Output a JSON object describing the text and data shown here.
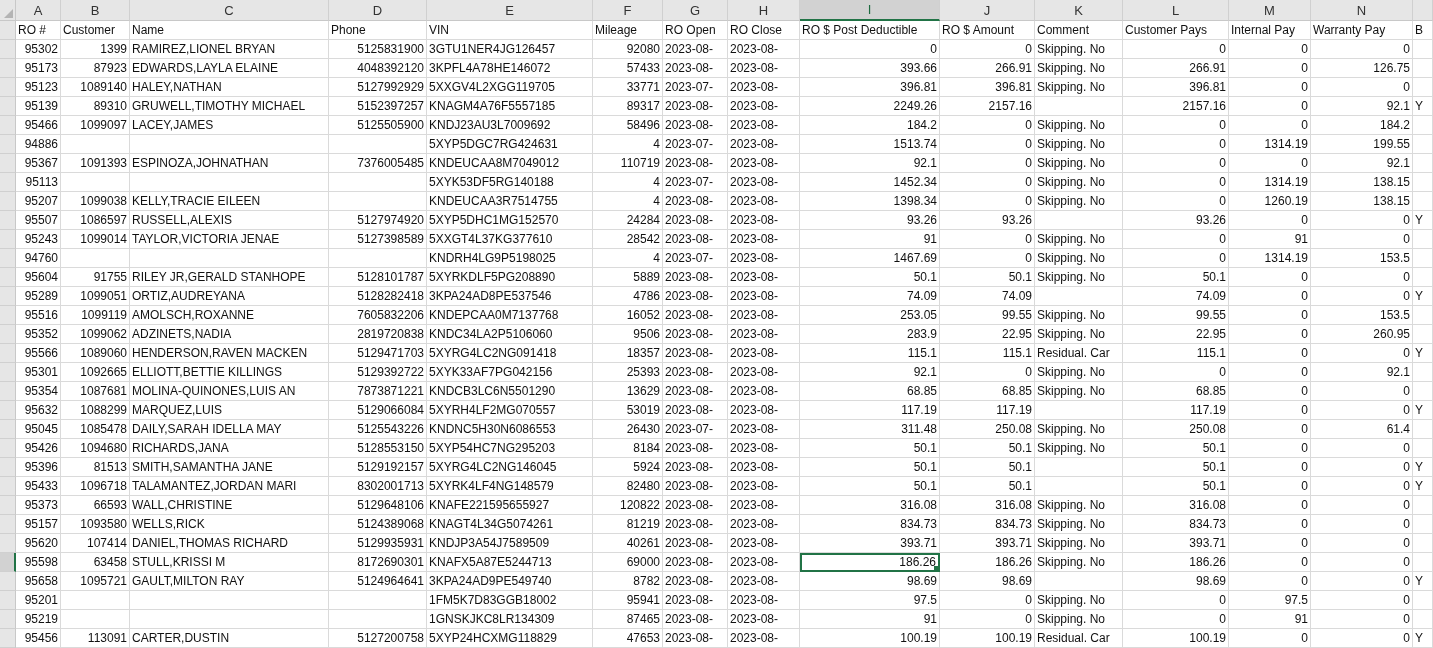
{
  "columns": [
    {
      "letter": "A",
      "selected": false
    },
    {
      "letter": "B",
      "selected": false
    },
    {
      "letter": "C",
      "selected": false
    },
    {
      "letter": "D",
      "selected": false
    },
    {
      "letter": "E",
      "selected": false
    },
    {
      "letter": "F",
      "selected": false
    },
    {
      "letter": "G",
      "selected": false
    },
    {
      "letter": "H",
      "selected": false
    },
    {
      "letter": "I",
      "selected": true
    },
    {
      "letter": "J",
      "selected": false
    },
    {
      "letter": "K",
      "selected": false
    },
    {
      "letter": "L",
      "selected": false
    },
    {
      "letter": "M",
      "selected": false
    },
    {
      "letter": "N",
      "selected": false
    },
    {
      "selected": false
    }
  ],
  "header_row": {
    "A": "RO #",
    "B": "Customer",
    "C": "Name",
    "D": "Phone",
    "E": "VIN",
    "F": "Mileage",
    "G": "RO Open",
    "H": "RO Close",
    "I": "RO $ Post Deductible",
    "J": "RO $ Amount",
    "K": "Comment",
    "L": "Customer Pays",
    "M": "Internal Pay",
    "N": "Warranty Pay",
    "O": "B"
  },
  "rows": [
    {
      "selected": false,
      "cells": {
        "A": "95302",
        "B": "1399",
        "C": "RAMIREZ,LIONEL BRYAN",
        "D": "5125831900",
        "E": "3GTU1NER4JG126457",
        "F": "92080",
        "G": "2023-08-",
        "H": "2023-08-",
        "I": "0",
        "J": "0",
        "K": "Skipping. No",
        "L": "0",
        "M": "0",
        "N": "0"
      }
    },
    {
      "selected": false,
      "cells": {
        "A": "95173",
        "B": "87923",
        "C": "EDWARDS,LAYLA ELAINE",
        "D": "4048392120",
        "E": "3KPFL4A78HE146072",
        "F": "57433",
        "G": "2023-08-",
        "H": "2023-08-",
        "I": "393.66",
        "J": "266.91",
        "K": "Skipping. No",
        "L": "266.91",
        "M": "0",
        "N": "126.75"
      }
    },
    {
      "selected": false,
      "cells": {
        "A": "95123",
        "B": "1089140",
        "C": "HALEY,NATHAN",
        "D": "5127992929",
        "E": "5XXGV4L2XGG119705",
        "F": "33771",
        "G": "2023-07-",
        "H": "2023-08-",
        "I": "396.81",
        "J": "396.81",
        "K": "Skipping. No",
        "L": "396.81",
        "M": "0",
        "N": "0"
      }
    },
    {
      "selected": false,
      "cells": {
        "A": "95139",
        "B": "89310",
        "C": "GRUWELL,TIMOTHY MICHAEL",
        "D": "5152397257",
        "E": "KNAGM4A76F5557185",
        "F": "89317",
        "G": "2023-08-",
        "H": "2023-08-",
        "I": "2249.26",
        "J": "2157.16",
        "L": "2157.16",
        "M": "0",
        "N": "92.1",
        "O": "Y"
      }
    },
    {
      "selected": false,
      "cells": {
        "A": "95466",
        "B": "1099097",
        "C": "LACEY,JAMES",
        "D": "5125505900",
        "E": "KNDJ23AU3L7009692",
        "F": "58496",
        "G": "2023-08-",
        "H": "2023-08-",
        "I": "184.2",
        "J": "0",
        "K": "Skipping. No",
        "L": "0",
        "M": "0",
        "N": "184.2"
      }
    },
    {
      "selected": false,
      "cells": {
        "A": "94886",
        "E": "5XYP5DGC7RG424631",
        "F": "4",
        "G": "2023-07-",
        "H": "2023-08-",
        "I": "1513.74",
        "J": "0",
        "K": "Skipping. No",
        "L": "0",
        "M": "1314.19",
        "N": "199.55"
      }
    },
    {
      "selected": false,
      "cells": {
        "A": "95367",
        "B": "1091393",
        "C": "ESPINOZA,JOHNATHAN",
        "D": "7376005485",
        "E": "KNDEUCAA8M7049012",
        "F": "110719",
        "G": "2023-08-",
        "H": "2023-08-",
        "I": "92.1",
        "J": "0",
        "K": "Skipping. No",
        "L": "0",
        "M": "0",
        "N": "92.1"
      }
    },
    {
      "selected": false,
      "cells": {
        "A": "95113",
        "E": "5XYK53DF5RG140188",
        "F": "4",
        "G": "2023-07-",
        "H": "2023-08-",
        "I": "1452.34",
        "J": "0",
        "K": "Skipping. No",
        "L": "0",
        "M": "1314.19",
        "N": "138.15"
      }
    },
    {
      "selected": false,
      "cells": {
        "A": "95207",
        "B": "1099038",
        "C": "KELLY,TRACIE EILEEN",
        "E": "KNDEUCAA3R7514755",
        "F": "4",
        "G": "2023-08-",
        "H": "2023-08-",
        "I": "1398.34",
        "J": "0",
        "K": "Skipping. No",
        "L": "0",
        "M": "1260.19",
        "N": "138.15"
      }
    },
    {
      "selected": false,
      "cells": {
        "A": "95507",
        "B": "1086597",
        "C": "RUSSELL,ALEXIS",
        "D": "5127974920",
        "E": "5XYP5DHC1MG152570",
        "F": "24284",
        "G": "2023-08-",
        "H": "2023-08-",
        "I": "93.26",
        "J": "93.26",
        "L": "93.26",
        "M": "0",
        "N": "0",
        "O": "Y"
      }
    },
    {
      "selected": false,
      "cells": {
        "A": "95243",
        "B": "1099014",
        "C": "TAYLOR,VICTORIA JENAE",
        "D": "5127398589",
        "E": "5XXGT4L37KG377610",
        "F": "28542",
        "G": "2023-08-",
        "H": "2023-08-",
        "I": "91",
        "J": "0",
        "K": "Skipping. No",
        "L": "0",
        "M": "91",
        "N": "0"
      }
    },
    {
      "selected": false,
      "cells": {
        "A": "94760",
        "E": "KNDRH4LG9P5198025",
        "F": "4",
        "G": "2023-07-",
        "H": "2023-08-",
        "I": "1467.69",
        "J": "0",
        "K": "Skipping. No",
        "L": "0",
        "M": "1314.19",
        "N": "153.5"
      }
    },
    {
      "selected": false,
      "cells": {
        "A": "95604",
        "B": "91755",
        "C": "RILEY JR,GERALD STANHOPE",
        "D": "5128101787",
        "E": "5XYRKDLF5PG208890",
        "F": "5889",
        "G": "2023-08-",
        "H": "2023-08-",
        "I": "50.1",
        "J": "50.1",
        "K": "Skipping. No",
        "L": "50.1",
        "M": "0",
        "N": "0"
      }
    },
    {
      "selected": false,
      "cells": {
        "A": "95289",
        "B": "1099051",
        "C": "ORTIZ,AUDREYANA",
        "D": "5128282418",
        "E": "3KPA24AD8PE537546",
        "F": "4786",
        "G": "2023-08-",
        "H": "2023-08-",
        "I": "74.09",
        "J": "74.09",
        "L": "74.09",
        "M": "0",
        "N": "0",
        "O": "Y"
      }
    },
    {
      "selected": false,
      "cells": {
        "A": "95516",
        "B": "1099119",
        "C": "AMOLSCH,ROXANNE",
        "D": "7605832206",
        "E": "KNDEPCAA0M7137768",
        "F": "16052",
        "G": "2023-08-",
        "H": "2023-08-",
        "I": "253.05",
        "J": "99.55",
        "K": "Skipping. No",
        "L": "99.55",
        "M": "0",
        "N": "153.5"
      }
    },
    {
      "selected": false,
      "cells": {
        "A": "95352",
        "B": "1099062",
        "C": "ADZINETS,NADIA",
        "D": "2819720838",
        "E": "KNDC34LA2P5106060",
        "F": "9506",
        "G": "2023-08-",
        "H": "2023-08-",
        "I": "283.9",
        "J": "22.95",
        "K": "Skipping. No",
        "L": "22.95",
        "M": "0",
        "N": "260.95"
      }
    },
    {
      "selected": false,
      "cells": {
        "A": "95566",
        "B": "1089060",
        "C": "HENDERSON,RAVEN MACKEN",
        "D": "5129471703",
        "E": "5XYRG4LC2NG091418",
        "F": "18357",
        "G": "2023-08-",
        "H": "2023-08-",
        "I": "115.1",
        "J": "115.1",
        "K": "Residual. Car",
        "L": "115.1",
        "M": "0",
        "N": "0",
        "O": "Y"
      }
    },
    {
      "selected": false,
      "cells": {
        "A": "95301",
        "B": "1092665",
        "C": "ELLIOTT,BETTIE KILLINGS",
        "D": "5129392722",
        "E": "5XYK33AF7PG042156",
        "F": "25393",
        "G": "2023-08-",
        "H": "2023-08-",
        "I": "92.1",
        "J": "0",
        "K": "Skipping. No",
        "L": "0",
        "M": "0",
        "N": "92.1"
      }
    },
    {
      "selected": false,
      "cells": {
        "A": "95354",
        "B": "1087681",
        "C": "MOLINA-QUINONES,LUIS AN",
        "D": "7873871221",
        "E": "KNDCB3LC6N5501290",
        "F": "13629",
        "G": "2023-08-",
        "H": "2023-08-",
        "I": "68.85",
        "J": "68.85",
        "K": "Skipping. No",
        "L": "68.85",
        "M": "0",
        "N": "0"
      }
    },
    {
      "selected": false,
      "cells": {
        "A": "95632",
        "B": "1088299",
        "C": "MARQUEZ,LUIS",
        "D": "5129066084",
        "E": "5XYRH4LF2MG070557",
        "F": "53019",
        "G": "2023-08-",
        "H": "2023-08-",
        "I": "117.19",
        "J": "117.19",
        "L": "117.19",
        "M": "0",
        "N": "0",
        "O": "Y"
      }
    },
    {
      "selected": false,
      "cells": {
        "A": "95045",
        "B": "1085478",
        "C": "DAILY,SARAH IDELLA MAY",
        "D": "5125543226",
        "E": "KNDNC5H30N6086553",
        "F": "26430",
        "G": "2023-07-",
        "H": "2023-08-",
        "I": "311.48",
        "J": "250.08",
        "K": "Skipping. No",
        "L": "250.08",
        "M": "0",
        "N": "61.4"
      }
    },
    {
      "selected": false,
      "cells": {
        "A": "95426",
        "B": "1094680",
        "C": "RICHARDS,JANA",
        "D": "5128553150",
        "E": "5XYP54HC7NG295203",
        "F": "8184",
        "G": "2023-08-",
        "H": "2023-08-",
        "I": "50.1",
        "J": "50.1",
        "K": "Skipping. No",
        "L": "50.1",
        "M": "0",
        "N": "0"
      }
    },
    {
      "selected": false,
      "cells": {
        "A": "95396",
        "B": "81513",
        "C": "SMITH,SAMANTHA JANE",
        "D": "5129192157",
        "E": "5XYRG4LC2NG146045",
        "F": "5924",
        "G": "2023-08-",
        "H": "2023-08-",
        "I": "50.1",
        "J": "50.1",
        "L": "50.1",
        "M": "0",
        "N": "0",
        "O": "Y"
      }
    },
    {
      "selected": false,
      "cells": {
        "A": "95433",
        "B": "1096718",
        "C": "TALAMANTEZ,JORDAN MARI",
        "D": "8302001713",
        "E": "5XYRK4LF4NG148579",
        "F": "82480",
        "G": "2023-08-",
        "H": "2023-08-",
        "I": "50.1",
        "J": "50.1",
        "L": "50.1",
        "M": "0",
        "N": "0",
        "O": "Y"
      }
    },
    {
      "selected": false,
      "cells": {
        "A": "95373",
        "B": "66593",
        "C": "WALL,CHRISTINE",
        "D": "5129648106",
        "E": "KNAFE221595655927",
        "F": "120822",
        "G": "2023-08-",
        "H": "2023-08-",
        "I": "316.08",
        "J": "316.08",
        "K": "Skipping. No",
        "L": "316.08",
        "M": "0",
        "N": "0"
      }
    },
    {
      "selected": false,
      "cells": {
        "A": "95157",
        "B": "1093580",
        "C": "WELLS,RICK",
        "D": "5124389068",
        "E": "KNAGT4L34G5074261",
        "F": "81219",
        "G": "2023-08-",
        "H": "2023-08-",
        "I": "834.73",
        "J": "834.73",
        "K": "Skipping. No",
        "L": "834.73",
        "M": "0",
        "N": "0"
      }
    },
    {
      "selected": false,
      "cells": {
        "A": "95620",
        "B": "107414",
        "C": "DANIEL,THOMAS RICHARD",
        "D": "5129935931",
        "E": "KNDJP3A54J7589509",
        "F": "40261",
        "G": "2023-08-",
        "H": "2023-08-",
        "I": "393.71",
        "J": "393.71",
        "K": "Skipping. No",
        "L": "393.71",
        "M": "0",
        "N": "0"
      }
    },
    {
      "selected": true,
      "cells": {
        "A": "95598",
        "B": "63458",
        "C": "STULL,KRISSI M",
        "D": "8172690301",
        "E": "KNAFX5A87E5244713",
        "F": "69000",
        "G": "2023-08-",
        "H": "2023-08-",
        "I": "186.26",
        "J": "186.26",
        "K": "Skipping. No",
        "L": "186.26",
        "M": "0",
        "N": "0"
      }
    },
    {
      "selected": false,
      "cells": {
        "A": "95658",
        "B": "1095721",
        "C": "GAULT,MILTON RAY",
        "D": "5124964641",
        "E": "3KPA24AD9PE549740",
        "F": "8782",
        "G": "2023-08-",
        "H": "2023-08-",
        "I": "98.69",
        "J": "98.69",
        "L": "98.69",
        "M": "0",
        "N": "0",
        "O": "Y"
      }
    },
    {
      "selected": false,
      "cells": {
        "A": "95201",
        "E": "1FM5K7D83GGB18002",
        "F": "95941",
        "G": "2023-08-",
        "H": "2023-08-",
        "I": "97.5",
        "J": "0",
        "K": "Skipping. No",
        "L": "0",
        "M": "97.5",
        "N": "0"
      }
    },
    {
      "selected": false,
      "cells": {
        "A": "95219",
        "E": "1GNSKJKC8LR134309",
        "F": "87465",
        "G": "2023-08-",
        "H": "2023-08-",
        "I": "91",
        "J": "0",
        "K": "Skipping. No",
        "L": "0",
        "M": "91",
        "N": "0"
      }
    },
    {
      "selected": false,
      "cells": {
        "A": "95456",
        "B": "113091",
        "C": "CARTER,DUSTIN",
        "D": "5127200758",
        "E": "5XYP24HCXMG118829",
        "F": "47653",
        "G": "2023-08-",
        "H": "2023-08-",
        "I": "100.19",
        "J": "100.19",
        "K": "Residual. Car",
        "L": "100.19",
        "M": "0",
        "N": "0",
        "O": "Y"
      }
    }
  ]
}
